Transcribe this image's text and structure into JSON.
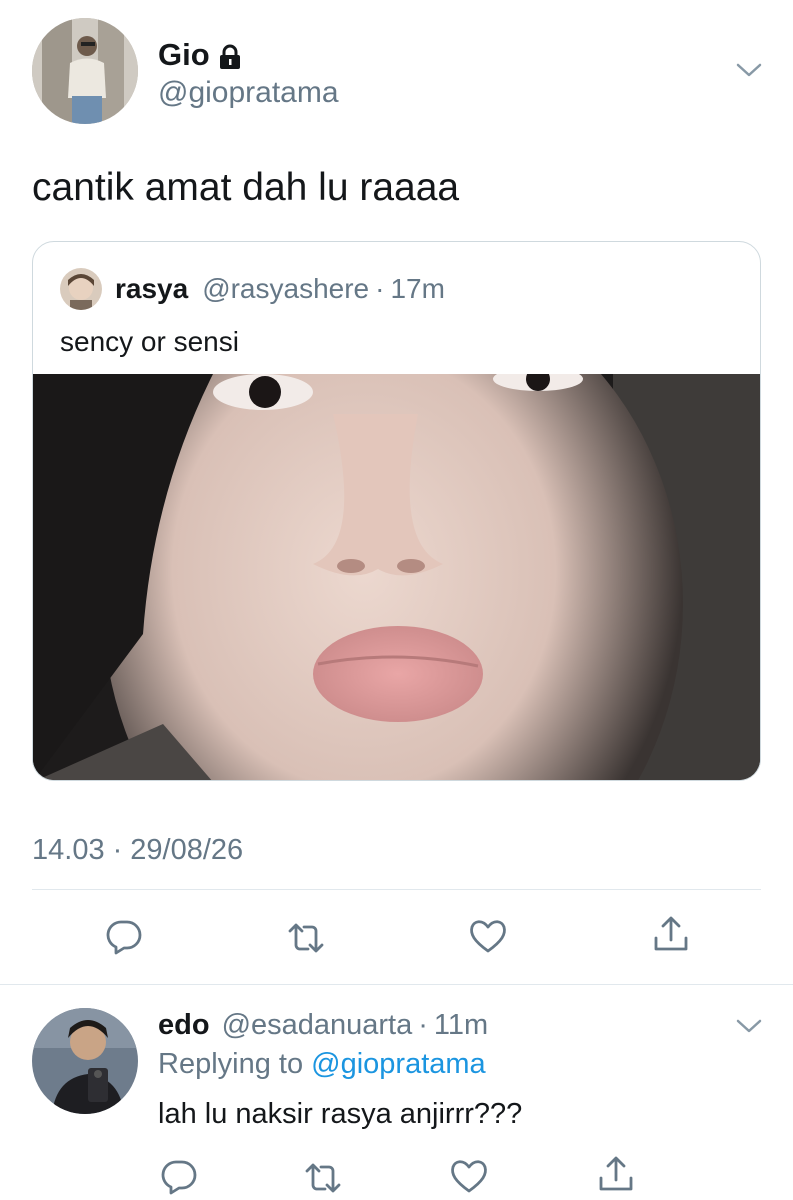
{
  "main_tweet": {
    "author_name": "Gio",
    "author_handle": "@giopratama",
    "locked_icon": "lock-icon",
    "text": "cantik amat dah lu raaaa",
    "timestamp_time": "14.03",
    "timestamp_separator": "·",
    "timestamp_date": "29/08/26"
  },
  "quoted_tweet": {
    "author_name": "rasya",
    "author_handle": "@rasyashere",
    "separator": "·",
    "time": "17m",
    "text": "sency or sensi"
  },
  "reply": {
    "author_name": "edo",
    "author_handle": "@esadanuarta",
    "separator": "·",
    "time": "11m",
    "replying_prefix": "Replying to",
    "replying_handle": "@giopratama",
    "text": "lah lu naksir rasya anjirrr???"
  },
  "icons": {
    "reply": "reply-icon",
    "retweet": "retweet-icon",
    "like": "heart-icon",
    "share": "share-icon",
    "more": "chevron-down-icon"
  },
  "colors": {
    "text_primary": "#14171a",
    "text_secondary": "#657786",
    "link": "#1b95e0",
    "border": "#cfd9de",
    "divider": "#e1e8ed"
  }
}
